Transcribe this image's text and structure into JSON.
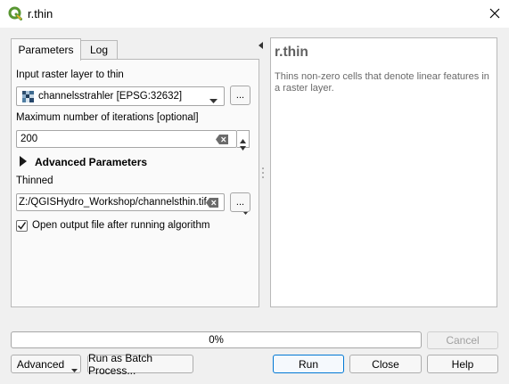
{
  "window": {
    "title": "r.thin",
    "app_icon": "qgis-logo-icon",
    "close_icon": "close-x-icon"
  },
  "tabs": [
    {
      "label": "Parameters",
      "active": true
    },
    {
      "label": "Log",
      "active": false
    }
  ],
  "params": {
    "input_label": "Input raster layer to thin",
    "input_value": "channelsstrahler [EPSG:32632]",
    "input_browse": "...",
    "iterations_label": "Maximum number of iterations [optional]",
    "iterations_value": "200",
    "advanced_label": "Advanced Parameters",
    "thinned_label": "Thinned",
    "thinned_value": "Z:/QGISHydro_Workshop/channelsthin.tif",
    "thinned_browse": "...",
    "open_output_label": "Open output file after running algorithm",
    "open_output_checked": true
  },
  "help": {
    "title": "r.thin",
    "description": "Thins non-zero cells that denote linear features in a raster layer."
  },
  "progress": {
    "value": 0,
    "text": "0%"
  },
  "buttons": {
    "cancel": "Cancel",
    "advanced": "Advanced",
    "batch": "Run as Batch Process...",
    "run": "Run",
    "close": "Close",
    "help": "Help"
  },
  "colors": {
    "accent": "#0078d4",
    "qgis_green": "#589632",
    "qgis_yellow": "#eeb32a"
  }
}
